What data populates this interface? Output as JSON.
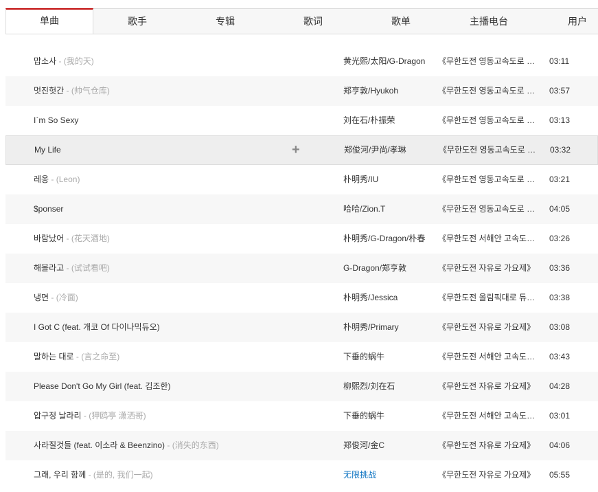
{
  "tabs": [
    {
      "label": "单曲",
      "active": true
    },
    {
      "label": "歌手",
      "active": false
    },
    {
      "label": "专辑",
      "active": false
    },
    {
      "label": "歌词",
      "active": false
    },
    {
      "label": "歌单",
      "active": false
    },
    {
      "label": "主播电台",
      "active": false
    },
    {
      "label": "用户",
      "active": false
    }
  ],
  "add_icon": "+",
  "songs": [
    {
      "title": "맙소사",
      "sep": " - ",
      "alias": "(我的天)",
      "artist": "黄光熙/太阳/G-Dragon",
      "album": "《무한도전 영동고속도로 가요제》",
      "duration": "03:11"
    },
    {
      "title": "멋진헛간",
      "sep": " - ",
      "alias": "(帅气仓库)",
      "artist": "郑亨敦/Hyukoh",
      "album": "《무한도전 영동고속도로 가요제》",
      "duration": "03:57"
    },
    {
      "title": "I`m So Sexy",
      "sep": "",
      "alias": "",
      "artist": "刘在石/朴振荣",
      "album": "《무한도전 영동고속도로 가요제》",
      "duration": "03:13"
    },
    {
      "title": "My Life",
      "sep": "",
      "alias": "",
      "artist": "郑俊河/尹尚/孝琳",
      "album": "《무한도전 영동고속도로 가요제》",
      "duration": "03:32"
    },
    {
      "title": "레옹",
      "sep": " - ",
      "alias": "(Leon)",
      "artist": "朴明秀/IU",
      "album": "《무한도전 영동고속도로 가요제》",
      "duration": "03:21"
    },
    {
      "title": "$ponser",
      "sep": "",
      "alias": "",
      "artist": "哈哈/Zion.T",
      "album": "《무한도전 영동고속도로 가요제》",
      "duration": "04:05"
    },
    {
      "title": "바람났어",
      "sep": " - ",
      "alias": "(花天酒地)",
      "artist": "朴明秀/G-Dragon/朴春",
      "album": "《무한도전 서해안 고속도로 가요제》",
      "duration": "03:26"
    },
    {
      "title": "해볼라고",
      "sep": " - ",
      "alias": "(试试看吧)",
      "artist": "G-Dragon/郑亨敦",
      "album": "《무한도전 자유로 가요제》",
      "duration": "03:36"
    },
    {
      "title": "냉면",
      "sep": " - ",
      "alias": "(冷面)",
      "artist": "朴明秀/Jessica",
      "album": "《무한도전 올림픽대로 듀엣가요제》",
      "duration": "03:38"
    },
    {
      "title": "I Got C (feat. 개코 Of 다이나믹듀오)",
      "sep": "",
      "alias": "",
      "artist": "朴明秀/Primary",
      "album": "《무한도전 자유로 가요제》",
      "duration": "03:08"
    },
    {
      "title": "말하는 대로",
      "sep": " - ",
      "alias": "(言之命至)",
      "artist": "下垂的蜗牛",
      "album": "《무한도전 서해안 고속도로 가요제》",
      "duration": "03:43"
    },
    {
      "title": "Please Don't Go My Girl (feat. 김조한)",
      "sep": "",
      "alias": "",
      "artist": "柳熙烈/刘在石",
      "album": "《무한도전 자유로 가요제》",
      "duration": "04:28"
    },
    {
      "title": "압구정 날라리",
      "sep": " - ",
      "alias": "(狎鸥亭 潇洒哥)",
      "artist": "下垂的蜗牛",
      "album": "《무한도전 서해안 고속도로 가요제》",
      "duration": "03:01"
    },
    {
      "title": "사라질것들 (feat. 이소라 & Beenzino)",
      "sep": " - ",
      "alias": "(消失的东西)",
      "artist": "郑俊河/金C",
      "album": "《무한도전 자유로 가요제》",
      "duration": "04:06"
    },
    {
      "title": "그래, 우리 함께",
      "sep": " - ",
      "alias": "(是的, 我们一起)",
      "artist": "无限挑战",
      "artist_link": true,
      "album": "《무한도전 자유로 가요제》",
      "duration": "05:55"
    }
  ]
}
